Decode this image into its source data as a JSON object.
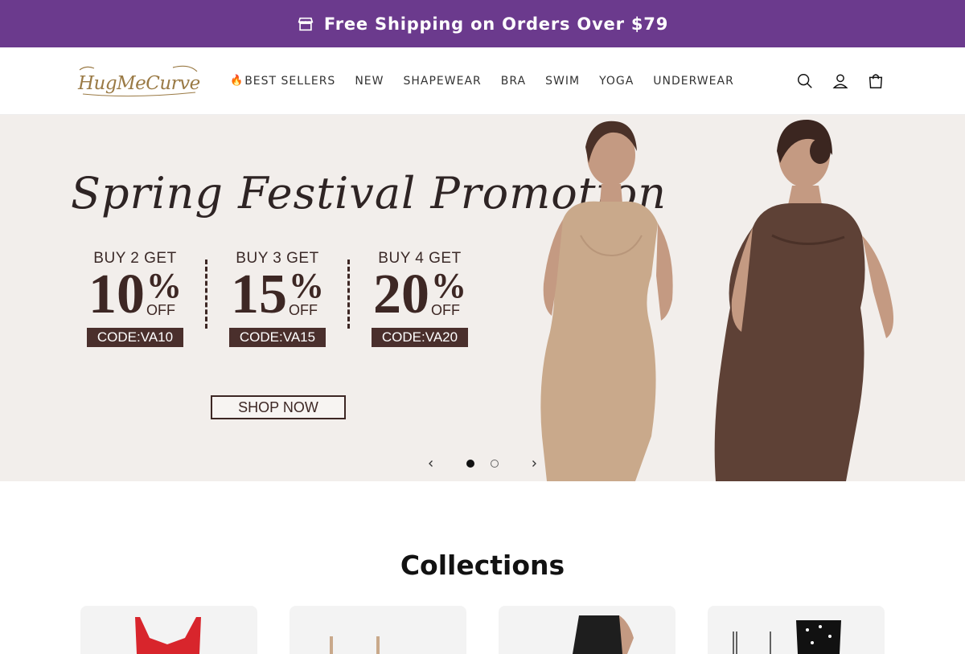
{
  "announcement": {
    "text": "Free Shipping on Orders Over $79",
    "icon": "shop-icon"
  },
  "header": {
    "logo_text": "HugMeCurve",
    "nav": [
      {
        "label": "BEST SELLERS",
        "icon": "fire-icon"
      },
      {
        "label": "NEW"
      },
      {
        "label": "SHAPEWEAR"
      },
      {
        "label": "BRA"
      },
      {
        "label": "SWIM"
      },
      {
        "label": "YOGA"
      },
      {
        "label": "UNDERWEAR"
      }
    ],
    "icons": [
      "search-icon",
      "account-icon",
      "cart-icon"
    ]
  },
  "hero": {
    "title": "Spring Festival Promotion",
    "offers": [
      {
        "head": "BUY 2 GET",
        "num": "10",
        "sym": "%",
        "off": "OFF",
        "code": "CODE:VA10"
      },
      {
        "head": "BUY 3 GET",
        "num": "15",
        "sym": "%",
        "off": "OFF",
        "code": "CODE:VA15"
      },
      {
        "head": "BUY 4 GET",
        "num": "20",
        "sym": "%",
        "off": "OFF",
        "code": "CODE:VA20"
      }
    ],
    "cta": "SHOP NOW",
    "slides_total": 2,
    "active_slide": 1
  },
  "collections": {
    "title": "Collections"
  },
  "colors": {
    "announcement_bg": "#6b3a8d",
    "hero_bg": "#f2eeeb",
    "accent_dark": "#3d2724",
    "logo_gold": "#9a7a45"
  }
}
